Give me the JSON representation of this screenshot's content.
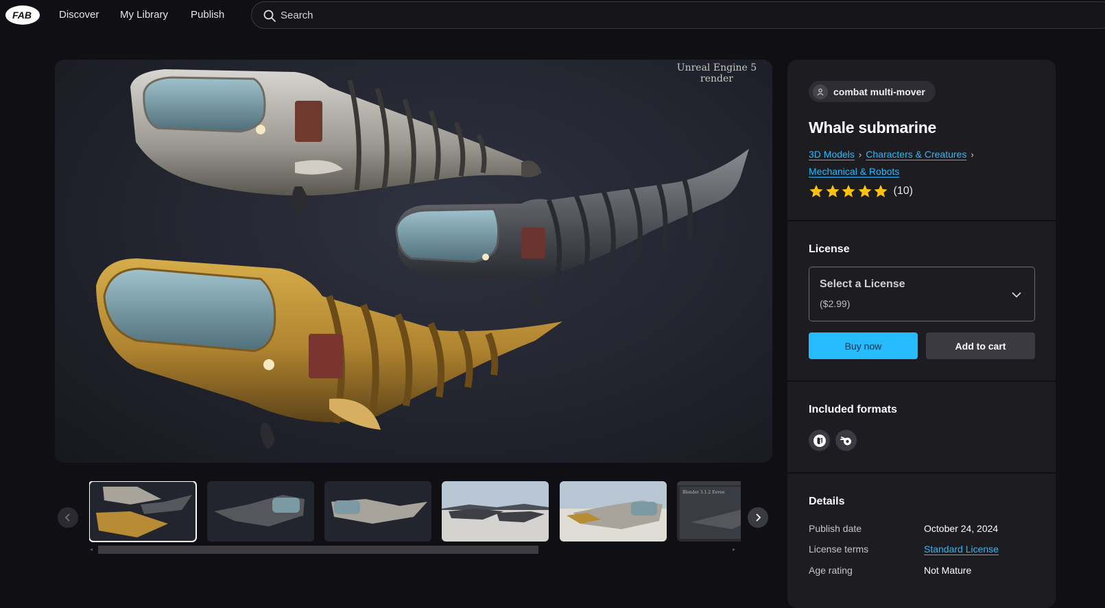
{
  "nav": {
    "logo_text": "FAB",
    "links": [
      "Discover",
      "My Library",
      "Publish"
    ],
    "search_placeholder": "Search"
  },
  "viewer": {
    "watermark": "Unreal Engine 5 render"
  },
  "thumbnails": [
    {
      "theme": "dark",
      "active": true
    },
    {
      "theme": "dark",
      "active": false
    },
    {
      "theme": "dark",
      "active": false
    },
    {
      "theme": "sky",
      "active": false
    },
    {
      "theme": "sky",
      "active": false
    },
    {
      "theme": "editor",
      "active": false,
      "caption": "Blender 3.1.2 Eevee"
    }
  ],
  "product": {
    "seller": "combat multi-mover",
    "title": "Whale submarine",
    "breadcrumbs": [
      "3D Models",
      "Characters & Creatures",
      "Mechanical & Robots"
    ],
    "rating": {
      "stars": 5,
      "count": "(10)"
    }
  },
  "license": {
    "heading": "License",
    "select_label": "Select a License",
    "price": "($2.99)",
    "buy_label": "Buy now",
    "cart_label": "Add to cart"
  },
  "formats": {
    "heading": "Included formats",
    "icons": [
      "unreal-engine-icon",
      "blender-icon"
    ]
  },
  "details": {
    "heading": "Details",
    "rows": [
      {
        "label": "Publish date",
        "value": "October 24, 2024",
        "link": false
      },
      {
        "label": "License terms",
        "value": "Standard License",
        "link": true
      },
      {
        "label": "Age rating",
        "value": "Not Mature",
        "link": false
      }
    ]
  },
  "colors": {
    "accent": "#26bbff",
    "background": "#101014",
    "panel": "#1c1c21",
    "star": "#ffc20e"
  }
}
